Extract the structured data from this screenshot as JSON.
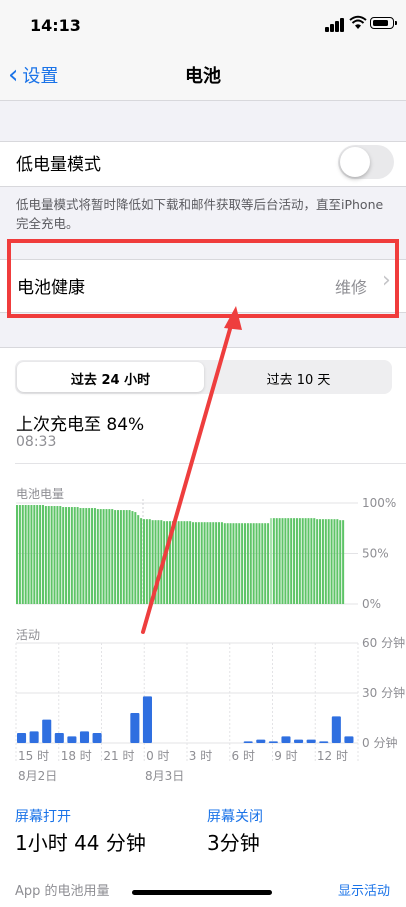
{
  "status": {
    "time": "14:13"
  },
  "nav": {
    "back_label": "设置",
    "title": "电池"
  },
  "low_power": {
    "label": "低电量模式",
    "enabled": false,
    "description": "低电量模式将暂时降低如下载和邮件获取等后台活动，直至iPhone完全充电。"
  },
  "battery_health": {
    "label": "电池健康",
    "value": "维修"
  },
  "tabs": [
    {
      "label": "过去 24 小时",
      "selected": true
    },
    {
      "label": "过去 10 天",
      "selected": false
    }
  ],
  "last_charge": {
    "text": "上次充电至 84%",
    "time": "08:33"
  },
  "chart_data": [
    {
      "type": "bar",
      "title": "电池电量",
      "y_ticks": [
        "100%",
        "50%",
        "0%"
      ],
      "ylim": [
        0,
        100
      ],
      "values": [
        98,
        98,
        98,
        98,
        98,
        98,
        98,
        98,
        98,
        98,
        97,
        97,
        97,
        97,
        97,
        97,
        96,
        96,
        96,
        96,
        96,
        96,
        95,
        95,
        95,
        95,
        95,
        95,
        94,
        94,
        94,
        94,
        94,
        94,
        93,
        93,
        93,
        93,
        93,
        93,
        92,
        91,
        88,
        85,
        84,
        84,
        84,
        83,
        83,
        83,
        83,
        82,
        82,
        82,
        82,
        82,
        82,
        82,
        82,
        82,
        82,
        81,
        81,
        81,
        81,
        81,
        81,
        81,
        81,
        81,
        81,
        81,
        80,
        80,
        80,
        80,
        80,
        80,
        80,
        80,
        80,
        80,
        80,
        80,
        80,
        80,
        80,
        80,
        85,
        85,
        85,
        85,
        85,
        85,
        85,
        85,
        85,
        85,
        85,
        85,
        85,
        85,
        85,
        85,
        84,
        84,
        84,
        84,
        84,
        84,
        84,
        84,
        83,
        83
      ],
      "charging_index": 88,
      "color": "#5ec467"
    },
    {
      "type": "bar",
      "title": "活动",
      "y_ticks": [
        "60 分钟",
        "30 分钟",
        "0 分钟"
      ],
      "ylim": [
        0,
        60
      ],
      "x_ticks": [
        "15 时",
        "18 时",
        "21 时",
        "0 时",
        "3 时",
        "6 时",
        "9 时",
        "12 时"
      ],
      "date_labels": [
        "8月2日",
        "8月3日"
      ],
      "values": [
        6,
        7,
        14,
        6,
        4,
        7,
        6,
        0,
        0,
        18,
        28,
        0,
        0,
        0,
        0,
        0,
        0,
        0,
        1,
        2,
        1,
        4,
        2,
        2,
        1,
        16,
        4
      ],
      "color": "#2f6fe0"
    }
  ],
  "screen_on": {
    "label": "屏幕打开",
    "value": "1小时 44 分钟"
  },
  "screen_off": {
    "label": "屏幕关闭",
    "value": "3分钟"
  },
  "app_usage": {
    "label": "App 的电池用量",
    "action": "显示活动"
  },
  "colors": {
    "accent": "#1a73e8",
    "highlight_box": "#f03c3c",
    "arrow": "#ee3e3e"
  }
}
